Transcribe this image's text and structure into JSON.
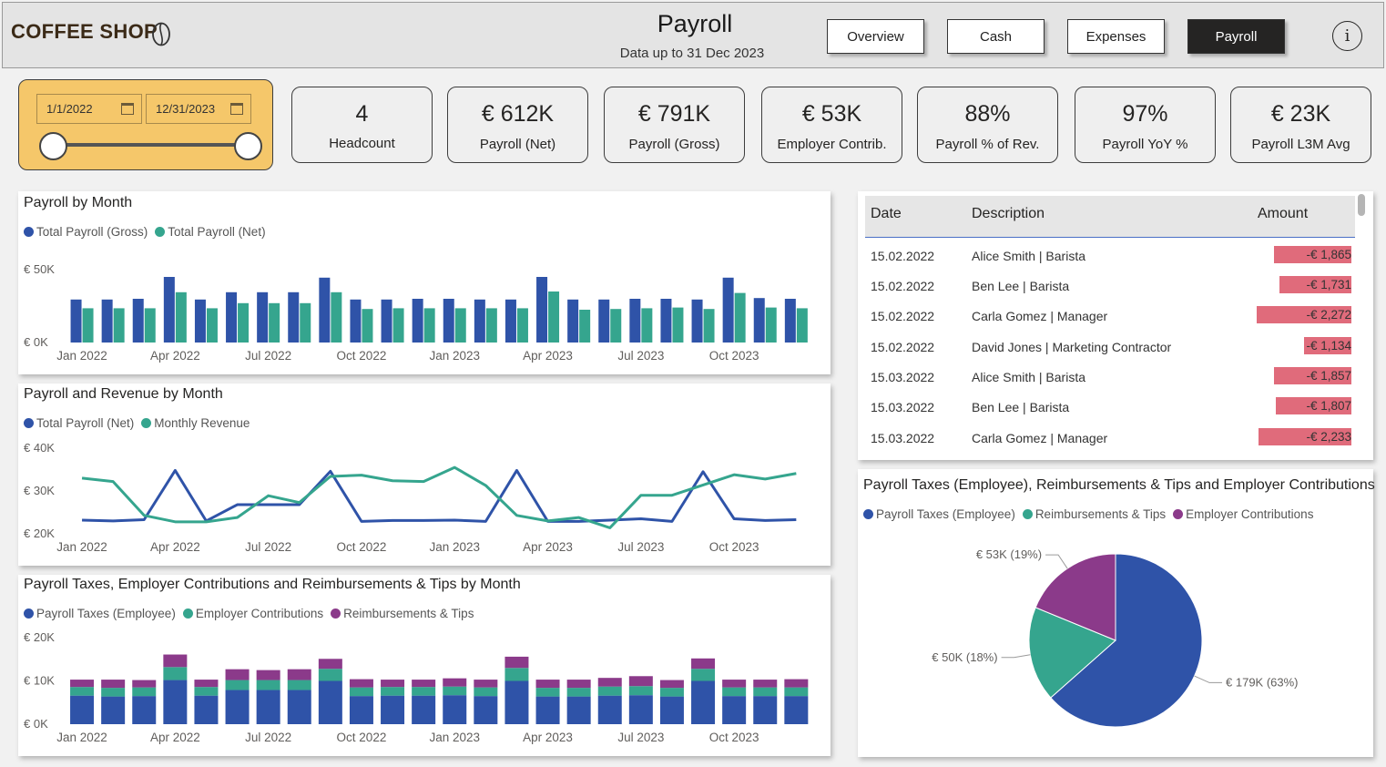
{
  "header": {
    "brand": "COFFEE SHOP",
    "title": "Payroll",
    "subtitle": "Data up to  31 Dec 2023",
    "nav": [
      "Overview",
      "Cash",
      "Expenses",
      "Payroll"
    ],
    "active_nav": "Payroll",
    "info_label": "i"
  },
  "slicer": {
    "start_date": "1/1/2022",
    "end_date": "12/31/2023",
    "range_start_fraction": 0,
    "range_end_fraction": 1
  },
  "kpis": [
    {
      "value": "4",
      "label": "Headcount"
    },
    {
      "value": "€ 612K",
      "label": "Payroll (Net)"
    },
    {
      "value": "€ 791K",
      "label": "Payroll (Gross)"
    },
    {
      "value": "€ 53K",
      "label": "Employer Contrib."
    },
    {
      "value": "88%",
      "label": "Payroll % of Rev."
    },
    {
      "value": "97%",
      "label": "Payroll YoY %"
    },
    {
      "value": "€ 23K",
      "label": "Payroll L3M Avg"
    }
  ],
  "colors": {
    "blue": "#2f53a8",
    "teal": "#35a58e",
    "purple": "#8b3a8a",
    "accent": "#f5c76a",
    "bar_pink": "#e06b7b"
  },
  "chart_data": [
    {
      "type": "bar",
      "title": "Payroll by Month",
      "xticks": [
        "Jan 2022",
        "Apr 2022",
        "Jul 2022",
        "Oct 2022",
        "Jan 2023",
        "Apr 2023",
        "Jul 2023",
        "Oct 2023"
      ],
      "yticks": [
        "€ 0K",
        "€ 50K"
      ],
      "ylim": [
        0,
        50000
      ],
      "months": 24,
      "series": [
        {
          "name": "Total Payroll (Gross)",
          "color": "#2f53a8",
          "values": [
            29500,
            29500,
            30000,
            45000,
            29500,
            34500,
            34500,
            34500,
            44500,
            29500,
            29500,
            30000,
            30000,
            29500,
            29500,
            45000,
            29500,
            29500,
            30000,
            30000,
            29500,
            44500,
            30500,
            30000
          ]
        },
        {
          "name": "Total Payroll (Net)",
          "color": "#35a58e",
          "values": [
            23500,
            23500,
            23500,
            34500,
            23500,
            27000,
            27000,
            27000,
            34500,
            23000,
            23500,
            23500,
            23500,
            23500,
            23500,
            35000,
            22500,
            23000,
            23500,
            24000,
            23000,
            34000,
            24000,
            23500
          ]
        }
      ]
    },
    {
      "type": "line",
      "title": "Payroll and Revenue by Month",
      "xticks": [
        "Jan 2022",
        "Apr 2022",
        "Jul 2022",
        "Oct 2022",
        "Jan 2023",
        "Apr 2023",
        "Jul 2023",
        "Oct 2023"
      ],
      "yticks": [
        "€ 20K",
        "€ 30K",
        "€ 40K"
      ],
      "ylim": [
        20000,
        40000
      ],
      "months": 24,
      "series": [
        {
          "name": "Total Payroll (Net)",
          "color": "#2f53a8",
          "values": [
            23200,
            23000,
            23300,
            34800,
            23000,
            26800,
            26800,
            26800,
            34600,
            22900,
            23100,
            23100,
            23200,
            22900,
            34800,
            22900,
            22900,
            23200,
            23500,
            22900,
            34500,
            23500,
            23100,
            23300
          ]
        },
        {
          "name": "Monthly Revenue",
          "color": "#35a58e",
          "values": [
            33000,
            32200,
            24300,
            22800,
            22800,
            23800,
            28900,
            27300,
            33400,
            33700,
            32400,
            32200,
            35500,
            31300,
            24300,
            23000,
            23800,
            21400,
            29000,
            29000,
            31400,
            33800,
            32800,
            34100
          ]
        }
      ]
    },
    {
      "type": "bar",
      "stacked": true,
      "title": "Payroll Taxes, Employer Contributions and Reimbursements & Tips by Month",
      "xticks": [
        "Jan 2022",
        "Apr 2022",
        "Jul 2022",
        "Oct 2022",
        "Jan 2023",
        "Apr 2023",
        "Jul 2023",
        "Oct 2023"
      ],
      "yticks": [
        "€ 0K",
        "€ 10K",
        "€ 20K"
      ],
      "ylim": [
        0,
        20000
      ],
      "months": 24,
      "series": [
        {
          "name": "Payroll Taxes (Employee)",
          "color": "#2f53a8",
          "values": [
            6600,
            6400,
            6500,
            10200,
            6600,
            7900,
            7900,
            7900,
            10000,
            6500,
            6600,
            6600,
            6700,
            6500,
            10000,
            6400,
            6400,
            6600,
            6700,
            6400,
            10000,
            6500,
            6500,
            6500
          ]
        },
        {
          "name": "Employer Contributions",
          "color": "#35a58e",
          "values": [
            2000,
            2000,
            2000,
            3000,
            2000,
            2300,
            2300,
            2300,
            2800,
            2000,
            2000,
            2000,
            2000,
            2000,
            3000,
            2000,
            2000,
            2100,
            2100,
            2000,
            2800,
            2000,
            2000,
            2000
          ]
        },
        {
          "name": "Reimbursements & Tips",
          "color": "#8b3a8a",
          "values": [
            1700,
            1900,
            1700,
            2900,
            1700,
            2500,
            2300,
            2500,
            2300,
            1900,
            1700,
            1700,
            1900,
            1800,
            2600,
            1900,
            1900,
            2000,
            2300,
            1800,
            2400,
            1800,
            1800,
            1900
          ]
        }
      ]
    },
    {
      "type": "pie",
      "title": "Payroll Taxes (Employee), Reimbursements & Tips and Employer Contributions",
      "slices": [
        {
          "name": "Payroll Taxes (Employee)",
          "color": "#2f53a8",
          "value": 179000,
          "label": "€ 179K (63%)"
        },
        {
          "name": "Reimbursements & Tips",
          "color": "#35a58e",
          "value": 50000,
          "label": "€ 50K (18%)"
        },
        {
          "name": "Employer Contributions",
          "color": "#8b3a8a",
          "value": 53000,
          "label": "€ 53K (19%)"
        }
      ]
    }
  ],
  "table": {
    "columns": [
      "Date",
      "Description",
      "Amount"
    ],
    "max_amount": 2272,
    "rows": [
      {
        "date": "15.02.2022",
        "desc": "Alice Smith | Barista",
        "amount": "-€ 1,865",
        "value": 1865
      },
      {
        "date": "15.02.2022",
        "desc": "Ben Lee | Barista",
        "amount": "-€ 1,731",
        "value": 1731
      },
      {
        "date": "15.02.2022",
        "desc": "Carla Gomez | Manager",
        "amount": "-€ 2,272",
        "value": 2272
      },
      {
        "date": "15.02.2022",
        "desc": "David Jones | Marketing Contractor",
        "amount": "-€ 1,134",
        "value": 1134
      },
      {
        "date": "15.03.2022",
        "desc": "Alice Smith | Barista",
        "amount": "-€ 1,857",
        "value": 1857
      },
      {
        "date": "15.03.2022",
        "desc": "Ben Lee | Barista",
        "amount": "-€ 1,807",
        "value": 1807
      },
      {
        "date": "15.03.2022",
        "desc": "Carla Gomez | Manager",
        "amount": "-€ 2,233",
        "value": 2233
      }
    ]
  }
}
